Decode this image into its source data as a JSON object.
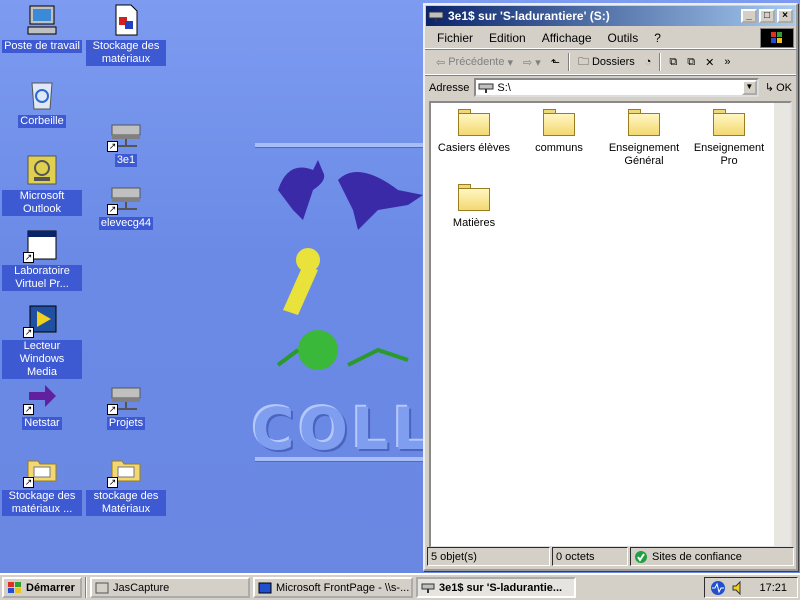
{
  "desktop": {
    "wallpaper_text": "COLL",
    "icons": [
      {
        "label": "Poste de travail",
        "icon": "computer-icon"
      },
      {
        "label": "Corbeille",
        "icon": "recycle-bin-icon"
      },
      {
        "label": "Microsoft Outlook",
        "icon": "outlook-icon"
      },
      {
        "label": "Laboratoire Virtuel Pr...",
        "icon": "window-app-icon"
      },
      {
        "label": "Lecteur Windows Media",
        "icon": "media-player-icon"
      },
      {
        "label": "Netstar",
        "icon": "arrow-icon"
      },
      {
        "label": "Stockage des matériaux ...",
        "icon": "network-folder-icon"
      },
      {
        "label": "Stockage des matériaux",
        "icon": "document-icon"
      },
      {
        "label": "3e1",
        "icon": "network-drive-icon"
      },
      {
        "label": "elevecg44",
        "icon": "network-drive-icon"
      },
      {
        "label": "Projets",
        "icon": "network-drive-icon"
      },
      {
        "label": "stockage des Matériaux",
        "icon": "network-folder-icon"
      }
    ]
  },
  "window": {
    "title": "3e1$ sur 'S-ladurantiere' (S:)",
    "menu": [
      "Fichier",
      "Edition",
      "Affichage",
      "Outils",
      "?"
    ],
    "toolbar": {
      "back_label": "Précédente",
      "folders_label": "Dossiers"
    },
    "address": {
      "label": "Adresse",
      "value": "S:\\",
      "go_label": "OK"
    },
    "folders": [
      {
        "name": "Casiers élèves"
      },
      {
        "name": "communs"
      },
      {
        "name": "Enseignement Général"
      },
      {
        "name": "Enseignement Pro"
      },
      {
        "name": "Matières"
      }
    ],
    "status": {
      "count": "5 objet(s)",
      "size": "0 octets",
      "zone": "Sites de confiance"
    }
  },
  "taskbar": {
    "start_label": "Démarrer",
    "tasks": [
      {
        "label": "JasCapture"
      },
      {
        "label": "Microsoft FrontPage - \\\\s-..."
      },
      {
        "label": "3e1$ sur 'S-ladurantie..."
      }
    ],
    "clock": "17:21"
  }
}
